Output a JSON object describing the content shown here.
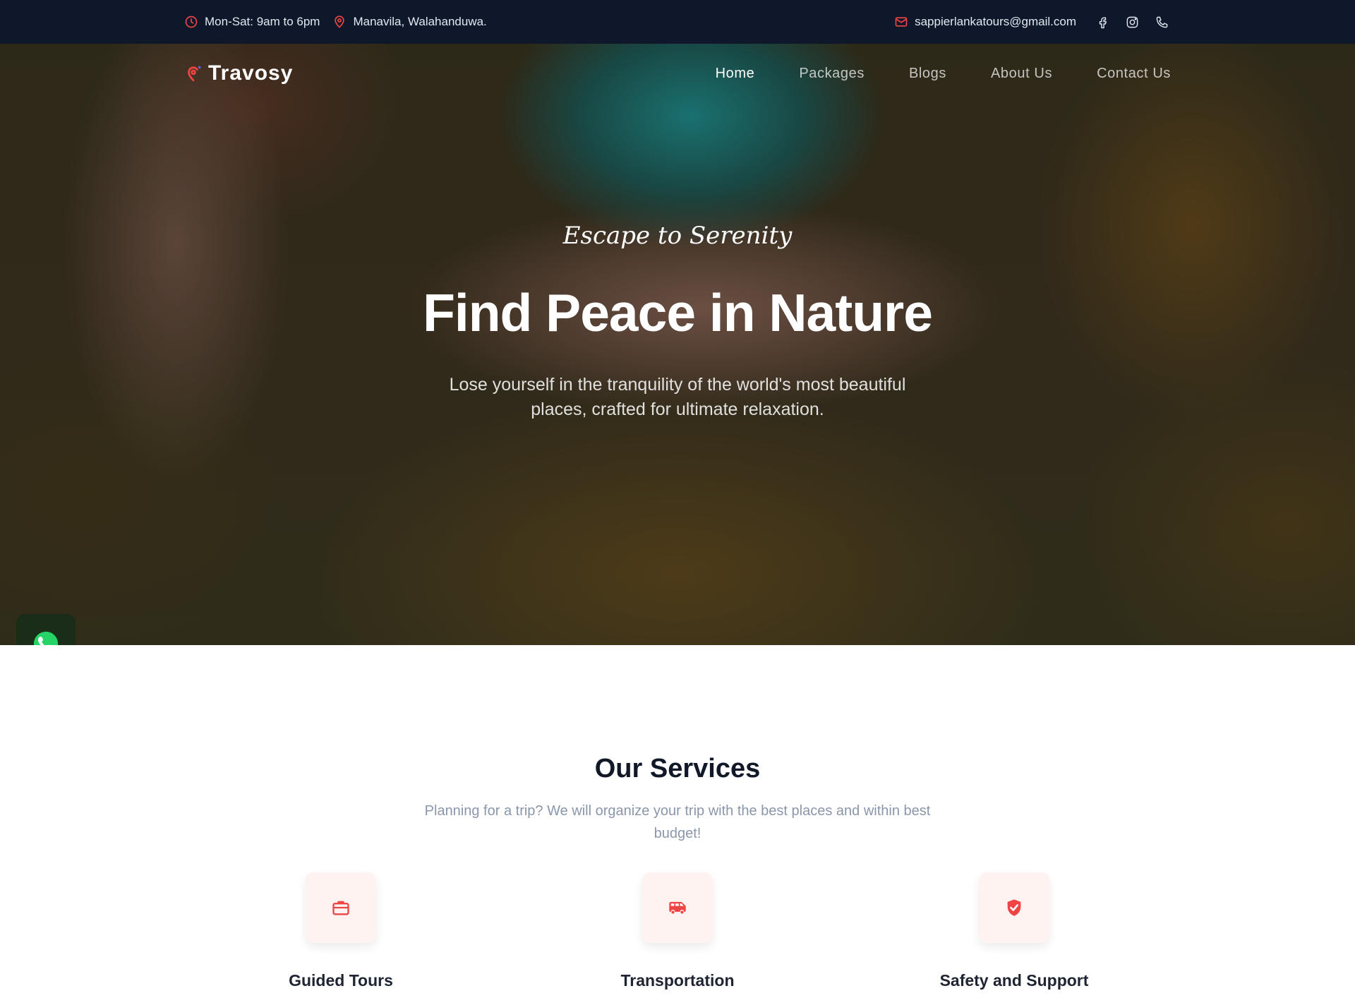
{
  "topbar": {
    "hours": "Mon-Sat: 9am to 6pm",
    "location": "Manavila, Walahanduwa.",
    "email": "sappierlankatours@gmail.com",
    "icons": [
      "clock-icon",
      "map-pin-icon",
      "mail-icon",
      "facebook-icon",
      "instagram-icon",
      "phone-icon"
    ]
  },
  "nav": {
    "brand": "Travosy",
    "items": [
      {
        "label": "Home",
        "active": true
      },
      {
        "label": "Packages",
        "active": false
      },
      {
        "label": "Blogs",
        "active": false
      },
      {
        "label": "About Us",
        "active": false
      },
      {
        "label": "Contact Us",
        "active": false
      }
    ]
  },
  "hero": {
    "tagline": "Escape to Serenity",
    "headline": "Find Peace in Nature",
    "subtext": "Lose yourself in the tranquility of the world's most beautiful places, crafted for ultimate relaxation."
  },
  "services": {
    "title": "Our Services",
    "subtitle": "Planning for a trip? We will organize your trip with the best places and within best budget!",
    "items": [
      {
        "label": "Guided Tours",
        "icon": "briefcase-icon"
      },
      {
        "label": "Transportation",
        "icon": "bus-icon"
      },
      {
        "label": "Safety and Support",
        "icon": "shield-check-icon"
      }
    ]
  },
  "colors": {
    "accent": "#ef4444",
    "topbar_bg": "#0f172a",
    "whatsapp": "#25d366"
  }
}
